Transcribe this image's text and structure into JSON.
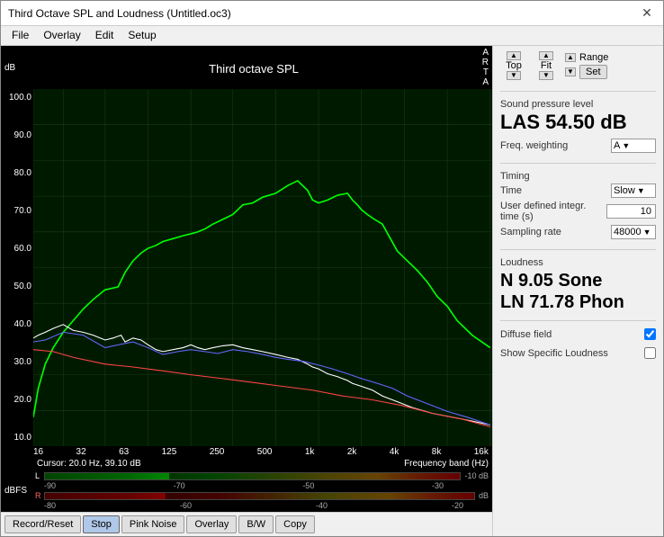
{
  "window": {
    "title": "Third Octave SPL and Loudness (Untitled.oc3)",
    "close_label": "✕"
  },
  "menu": {
    "items": [
      "File",
      "Overlay",
      "Edit",
      "Setup"
    ]
  },
  "chart": {
    "title": "Third octave SPL",
    "y_axis_label": "dB",
    "x_axis_label": "Frequency band (Hz)",
    "side_label": "A\nR\nT\nA",
    "cursor_text": "Cursor:  20.0 Hz, 39.10 dB",
    "y_ticks": [
      "100.0",
      "90.0",
      "80.0",
      "70.0",
      "60.0",
      "50.0",
      "40.0",
      "30.0",
      "20.0",
      "10.0"
    ],
    "x_ticks": [
      "16",
      "32",
      "63",
      "125",
      "250",
      "500",
      "1k",
      "2k",
      "4k",
      "8k",
      "16k"
    ]
  },
  "top_controls": {
    "top_label": "Top",
    "fit_label": "Fit",
    "range_label": "Range",
    "set_label": "Set"
  },
  "spl": {
    "section_label": "Sound pressure level",
    "value": "LAS 54.50 dB"
  },
  "freq_weighting": {
    "label": "Freq. weighting",
    "value": "A"
  },
  "timing": {
    "section_label": "Timing",
    "time_label": "Time",
    "time_value": "Slow",
    "user_defined_label": "User defined integr. time (s)",
    "user_defined_value": "10",
    "sampling_rate_label": "Sampling rate",
    "sampling_rate_value": "48000"
  },
  "loudness": {
    "section_label": "Loudness",
    "n_value": "N 9.05 Sone",
    "ln_value": "LN 71.78 Phon",
    "diffuse_field_label": "Diffuse field",
    "diffuse_field_checked": true,
    "show_specific_label": "Show Specific Loudness",
    "show_specific_checked": false
  },
  "dbfs": {
    "label": "dBFS",
    "l_label": "L",
    "r_label": "R",
    "ticks": [
      "-90",
      "-70",
      "-50",
      "-30",
      "-10 dB"
    ],
    "ticks_r": [
      "-80",
      "-60",
      "-40",
      "-20",
      "dB"
    ]
  },
  "buttons": {
    "record_reset": "Record/Reset",
    "stop": "Stop",
    "pink_noise": "Pink Noise",
    "overlay": "Overlay",
    "bw": "B/W",
    "copy": "Copy"
  }
}
